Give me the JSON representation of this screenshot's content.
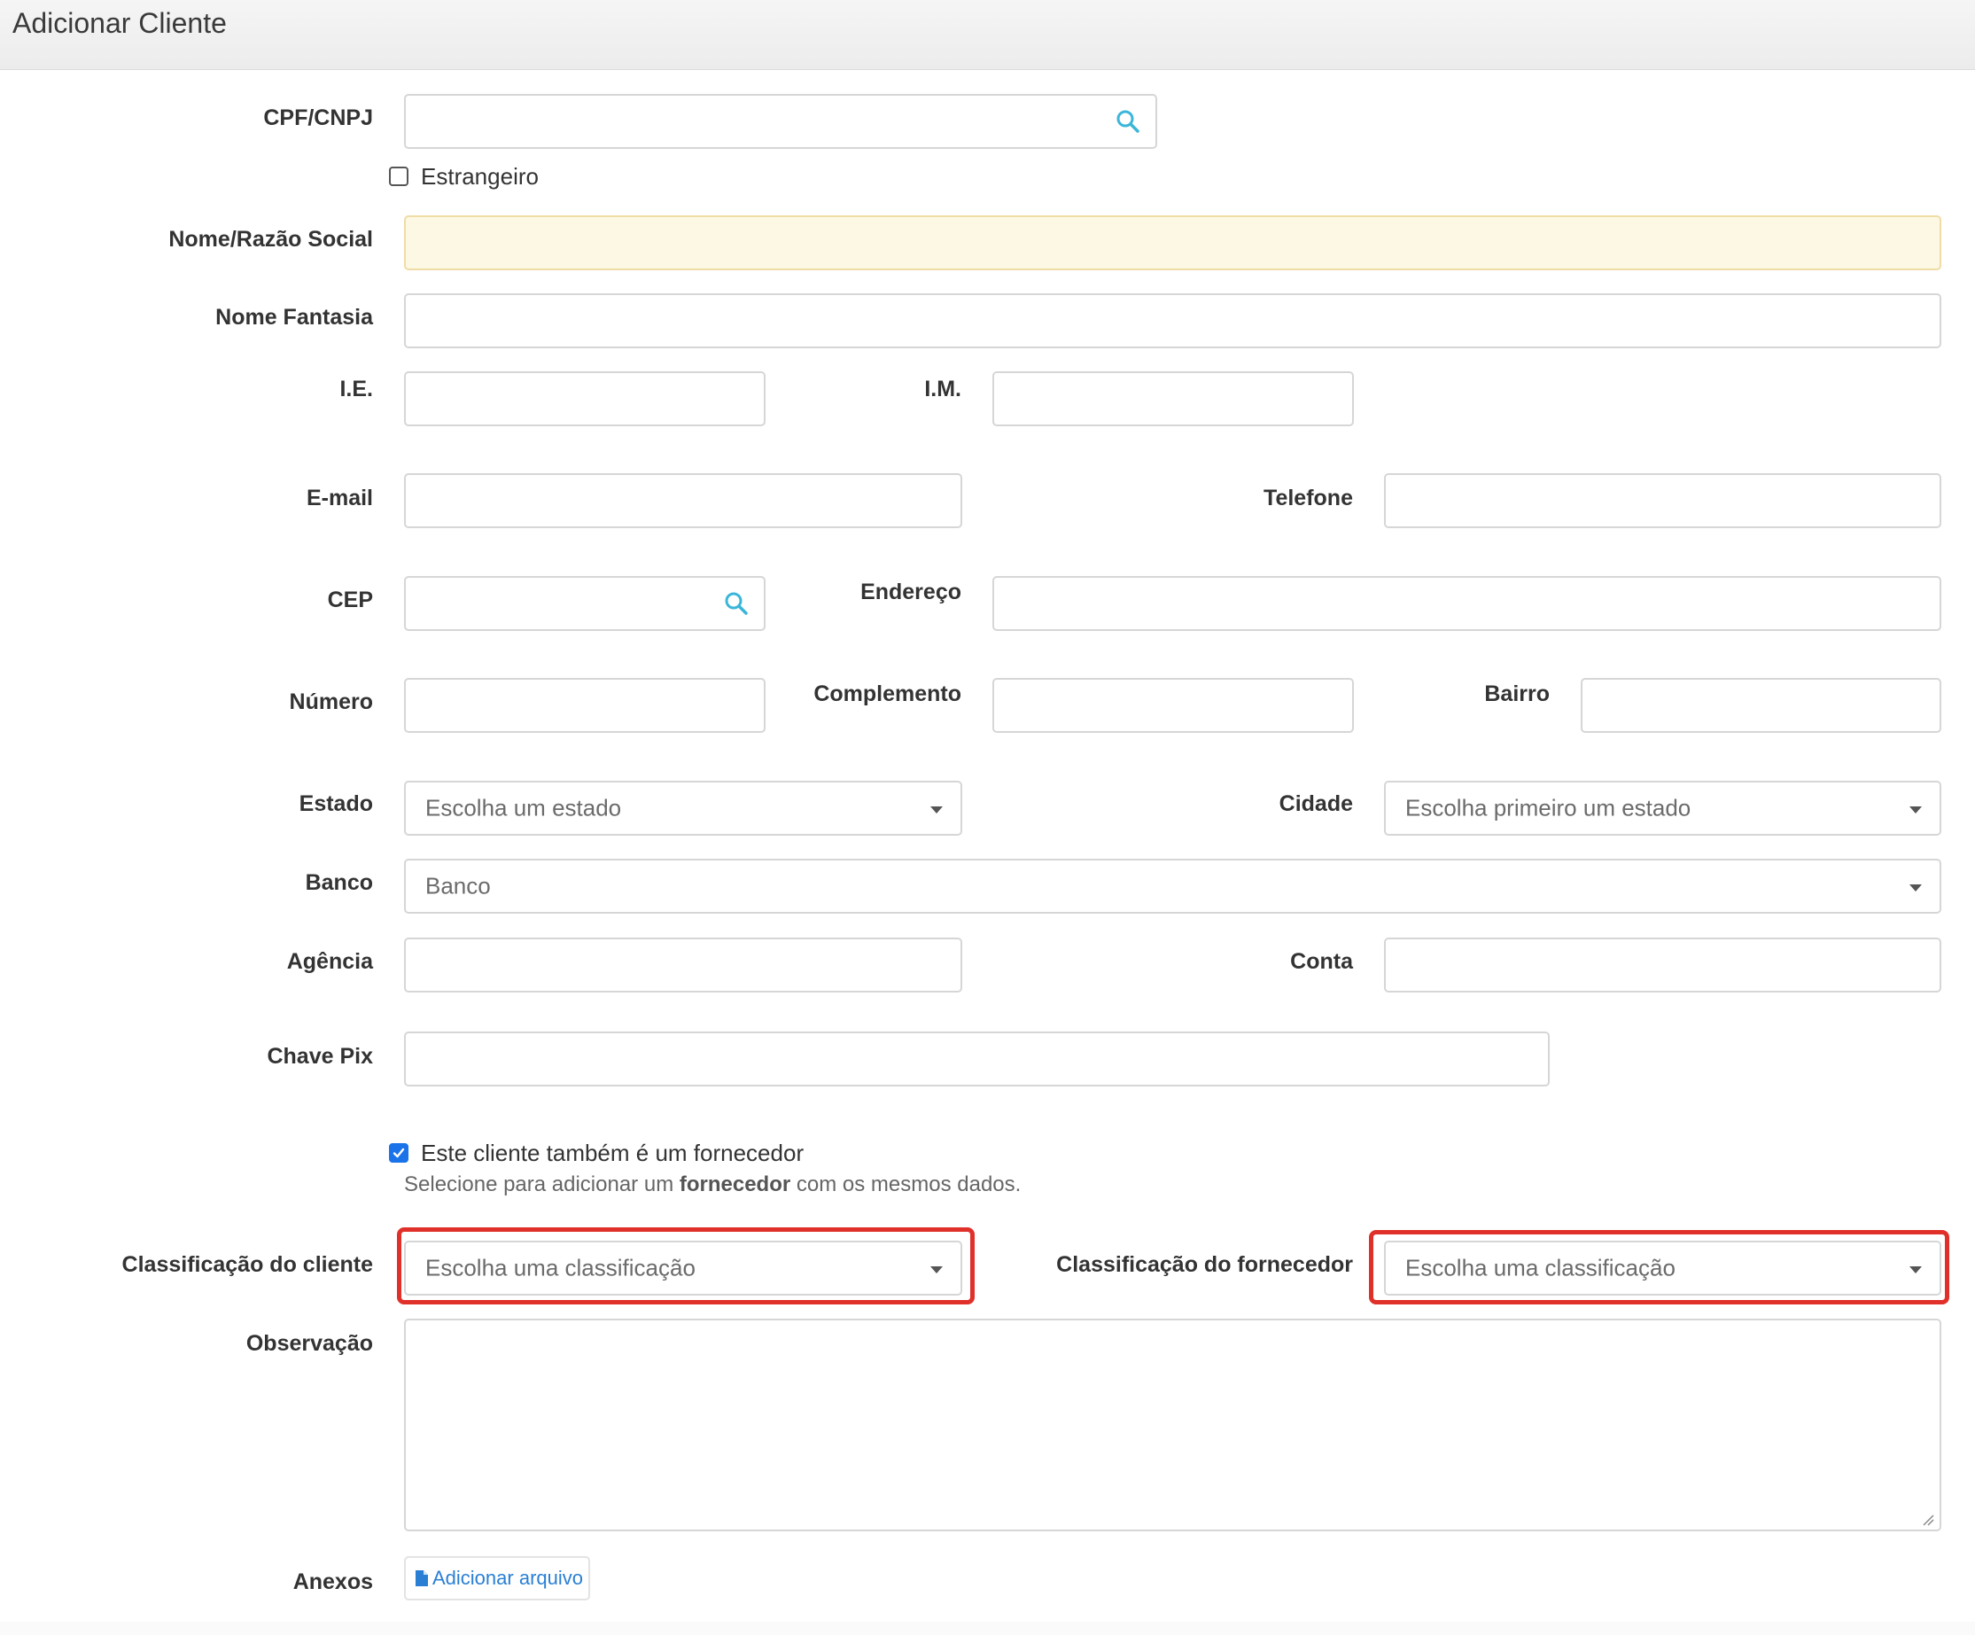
{
  "header": {
    "title": "Adicionar Cliente"
  },
  "form": {
    "cpf_cnpj": {
      "label": "CPF/CNPJ",
      "value": ""
    },
    "estrangeiro": {
      "label": "Estrangeiro",
      "checked": false
    },
    "nome_razao_social": {
      "label": "Nome/Razão Social",
      "value": ""
    },
    "nome_fantasia": {
      "label": "Nome Fantasia",
      "value": ""
    },
    "ie": {
      "label": "I.E.",
      "value": ""
    },
    "im": {
      "label": "I.M.",
      "value": ""
    },
    "email": {
      "label": "E-mail",
      "value": ""
    },
    "telefone": {
      "label": "Telefone",
      "value": ""
    },
    "cep": {
      "label": "CEP",
      "value": ""
    },
    "endereco": {
      "label": "Endereço",
      "value": ""
    },
    "numero": {
      "label": "Número",
      "value": ""
    },
    "complemento": {
      "label": "Complemento",
      "value": ""
    },
    "bairro": {
      "label": "Bairro",
      "value": ""
    },
    "estado": {
      "label": "Estado",
      "placeholder": "Escolha um estado"
    },
    "cidade": {
      "label": "Cidade",
      "placeholder": "Escolha primeiro um estado"
    },
    "banco": {
      "label": "Banco",
      "placeholder": "Banco"
    },
    "agencia": {
      "label": "Agência",
      "value": ""
    },
    "conta": {
      "label": "Conta",
      "value": ""
    },
    "chave_pix": {
      "label": "Chave Pix",
      "value": ""
    },
    "fornecedor_checkbox": {
      "label": "Este cliente também é um fornecedor",
      "checked": true,
      "help_pre": "Selecione para adicionar um ",
      "help_bold": "fornecedor",
      "help_post": " com os mesmos dados."
    },
    "classificacao_cliente": {
      "label": "Classificação do cliente",
      "placeholder": "Escolha uma classificação"
    },
    "classificacao_fornecedor": {
      "label": "Classificação do fornecedor",
      "placeholder": "Escolha uma classificação"
    },
    "observacao": {
      "label": "Observação",
      "value": ""
    },
    "anexos": {
      "label": "Anexos",
      "button_label": "Adicionar arquivo"
    }
  },
  "colors": {
    "highlight": "#e0302a",
    "accent": "#1a73e8",
    "link": "#2a7fd4",
    "search_icon": "#3bb6d8",
    "required_bg": "#fcf8e3"
  }
}
